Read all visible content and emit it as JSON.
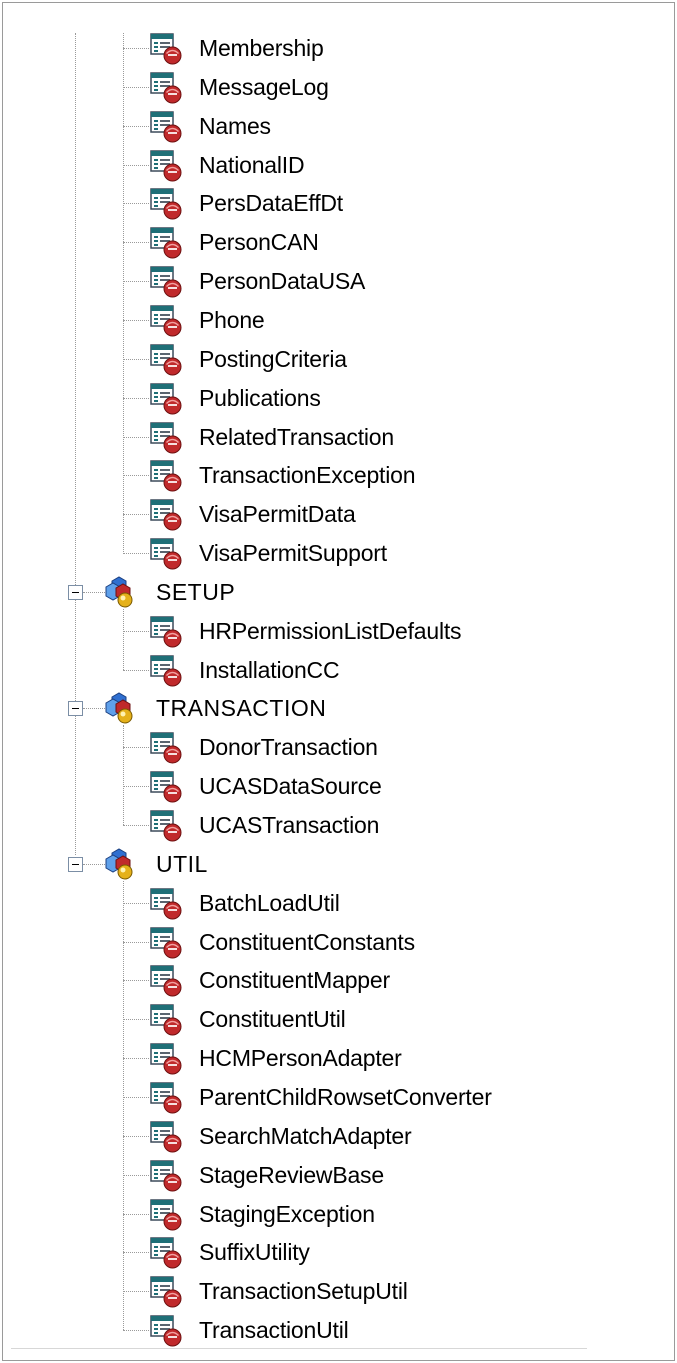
{
  "tree": {
    "pre_items": [
      "Membership",
      "MessageLog",
      "Names",
      "NationalID",
      "PersDataEffDt",
      "PersonCAN",
      "PersonDataUSA",
      "Phone",
      "PostingCriteria",
      "Publications",
      "RelatedTransaction",
      "TransactionException",
      "VisaPermitData",
      "VisaPermitSupport"
    ],
    "packages": [
      {
        "name": "SETUP",
        "items": [
          "HRPermissionListDefaults",
          "InstallationCC"
        ]
      },
      {
        "name": "TRANSACTION",
        "items": [
          "DonorTransaction",
          "UCASDataSource",
          "UCASTransaction"
        ]
      },
      {
        "name": "UTIL",
        "items": [
          "BatchLoadUtil",
          "ConstituentConstants",
          "ConstituentMapper",
          "ConstituentUtil",
          "HCMPersonAdapter",
          "ParentChildRowsetConverter",
          "SearchMatchAdapter",
          "StageReviewBase",
          "StagingException",
          "SuffixUtility",
          "TransactionSetupUtil",
          "TransactionUtil"
        ]
      }
    ]
  },
  "icons": {
    "class": "app-class-icon",
    "package": "app-package-icon",
    "toggle": "collapse-minus-icon"
  },
  "colors": {
    "tree_line": "#9a9a9a",
    "icon_red": "#c0292b",
    "icon_gold": "#e5b11a",
    "icon_blue": "#2f6fd0"
  }
}
